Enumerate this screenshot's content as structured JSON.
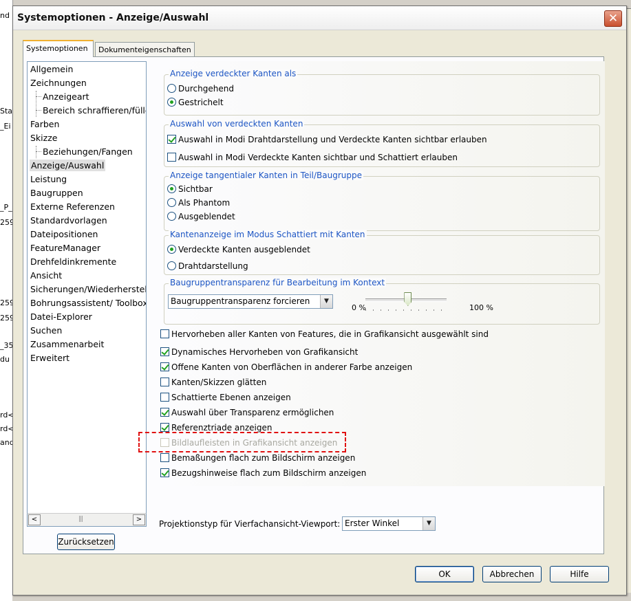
{
  "background_app": {
    "fragments": [
      "nd",
      "Sta",
      "_Ei",
      "_P_",
      "259",
      "259",
      "259",
      "_35",
      "du",
      "rd<",
      "rd<",
      "and"
    ]
  },
  "dialog": {
    "title": "Systemoptionen - Anzeige/Auswahl",
    "close_glyph": "✕"
  },
  "tabs": [
    {
      "label": "Systemoptionen",
      "active": true
    },
    {
      "label": "Dokumenteigenschaften",
      "active": false
    }
  ],
  "tree": {
    "items": [
      {
        "label": "Allgemein",
        "level": 0
      },
      {
        "label": "Zeichnungen",
        "level": 0
      },
      {
        "label": "Anzeigeart",
        "level": 1
      },
      {
        "label": "Bereich schraffieren/füllen",
        "level": 1
      },
      {
        "label": "Farben",
        "level": 0
      },
      {
        "label": "Skizze",
        "level": 0
      },
      {
        "label": "Beziehungen/Fangen",
        "level": 1
      },
      {
        "label": "Anzeige/Auswahl",
        "level": 0,
        "selected": true
      },
      {
        "label": "Leistung",
        "level": 0
      },
      {
        "label": "Baugruppen",
        "level": 0
      },
      {
        "label": "Externe Referenzen",
        "level": 0
      },
      {
        "label": "Standardvorlagen",
        "level": 0
      },
      {
        "label": "Dateipositionen",
        "level": 0
      },
      {
        "label": "FeatureManager",
        "level": 0
      },
      {
        "label": "Drehfeldinkremente",
        "level": 0
      },
      {
        "label": "Ansicht",
        "level": 0
      },
      {
        "label": "Sicherungen/Wiederherstellen",
        "level": 0
      },
      {
        "label": "Bohrungsassistent/ Toolbox",
        "level": 0
      },
      {
        "label": "Datei-Explorer",
        "level": 0
      },
      {
        "label": "Suchen",
        "level": 0
      },
      {
        "label": "Zusammenarbeit",
        "level": 0
      },
      {
        "label": "Erweitert",
        "level": 0
      }
    ],
    "scroll_left": "<",
    "scroll_right": ">",
    "scroll_grip": "|||",
    "reset_label": "Zurücksetzen"
  },
  "groups": {
    "hidden_edges": {
      "title": "Anzeige verdeckter Kanten als",
      "options": [
        {
          "label": "Durchgehend",
          "checked": false
        },
        {
          "label": "Gestrichelt",
          "checked": true
        }
      ]
    },
    "select_hidden": {
      "title": "Auswahl von verdeckten Kanten",
      "options": [
        {
          "label": "Auswahl in Modi Drahtdarstellung und Verdeckte Kanten sichtbar erlauben",
          "checked": true
        },
        {
          "label": "Auswahl in Modi Verdeckte Kanten sichtbar und Schattiert erlauben",
          "checked": false
        }
      ]
    },
    "tangent_edges": {
      "title": "Anzeige tangentialer Kanten in Teil/Baugruppe",
      "options": [
        {
          "label": "Sichtbar",
          "checked": true
        },
        {
          "label": "Als Phantom",
          "checked": false
        },
        {
          "label": "Ausgeblendet",
          "checked": false
        }
      ]
    },
    "shaded_edges": {
      "title": "Kantenanzeige im Modus Schattiert mit Kanten",
      "options": [
        {
          "label": "Verdeckte Kanten ausgeblendet",
          "checked": true
        },
        {
          "label": "Drahtdarstellung",
          "checked": false
        }
      ]
    },
    "transparency": {
      "title": "Baugruppentransparenz für Bearbeitung im Kontext",
      "combo_value": "Baugruppentransparenz forcieren",
      "min_label": "0 %",
      "max_label": "100 %",
      "slider_value_percent": 52
    }
  },
  "checkboxes": [
    {
      "label": "Hervorheben aller Kanten von Features, die in Grafikansicht ausgewählt sind",
      "checked": false,
      "disabled": false
    },
    {
      "label": "Dynamisches Hervorheben von Grafikansicht",
      "checked": true,
      "disabled": false
    },
    {
      "label": "Offene Kanten von Oberflächen in anderer Farbe anzeigen",
      "checked": true,
      "disabled": false
    },
    {
      "label": "Kanten/Skizzen glätten",
      "checked": false,
      "disabled": false
    },
    {
      "label": "Schattierte Ebenen anzeigen",
      "checked": false,
      "disabled": false
    },
    {
      "label": "Auswahl über Transparenz ermöglichen",
      "checked": true,
      "disabled": false
    },
    {
      "label": "Referenztriade anzeigen",
      "checked": true,
      "disabled": false
    },
    {
      "label": "Bildlaufleisten in Grafikansicht anzeigen",
      "checked": false,
      "disabled": true
    },
    {
      "label": "Bemaßungen flach zum Bildschirm anzeigen",
      "checked": false,
      "disabled": false
    },
    {
      "label": "Bezugshinweise flach zum Bildschirm anzeigen",
      "checked": true,
      "disabled": false
    }
  ],
  "projection": {
    "label": "Projektionstyp für Vierfachansicht-Viewport:",
    "value": "Erster Winkel"
  },
  "buttons": {
    "ok": "OK",
    "cancel": "Abbrechen",
    "help": "Hilfe"
  },
  "colors": {
    "group_title": "#1c55c4",
    "check_mark": "#21a121",
    "highlight": "#e01010"
  }
}
